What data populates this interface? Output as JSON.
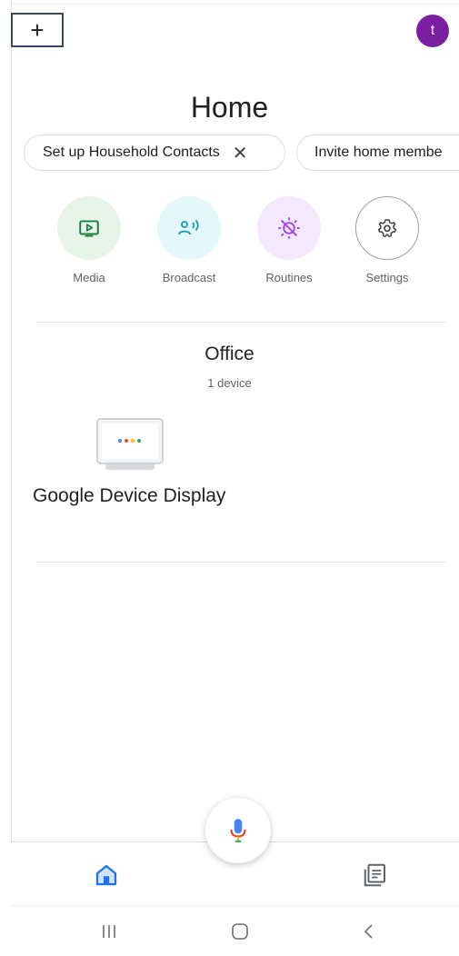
{
  "header": {
    "add_label": "+",
    "avatar_initial": "t",
    "title": "Home"
  },
  "chips": [
    {
      "label": "Set up Household Contacts",
      "close": "✕"
    },
    {
      "label": "Invite home membe"
    }
  ],
  "actions": [
    {
      "label": "Media",
      "icon": "media-icon",
      "bg": "#e6f4ea",
      "color": "#188038"
    },
    {
      "label": "Broadcast",
      "icon": "broadcast-icon",
      "bg": "#e4f7fb",
      "color": "#129eaf"
    },
    {
      "label": "Routines",
      "icon": "routines-icon",
      "bg": "#f3e8fd",
      "color": "#a142f4"
    },
    {
      "label": "Settings",
      "icon": "gear-icon",
      "bg": "#ffffff",
      "color": "#3c4043"
    }
  ],
  "room": {
    "name": "Office",
    "count": "1 device"
  },
  "device": {
    "name": "Google Device Display",
    "icon": "smart-display-icon"
  },
  "bottom_tabs": [
    {
      "name": "home",
      "icon": "home-icon",
      "color": "#1a73e8"
    },
    {
      "name": "feed",
      "icon": "feed-icon",
      "color": "#5f6368"
    }
  ],
  "colors": {
    "accent": "#1a73e8",
    "avatar": "#7b1fa2"
  }
}
